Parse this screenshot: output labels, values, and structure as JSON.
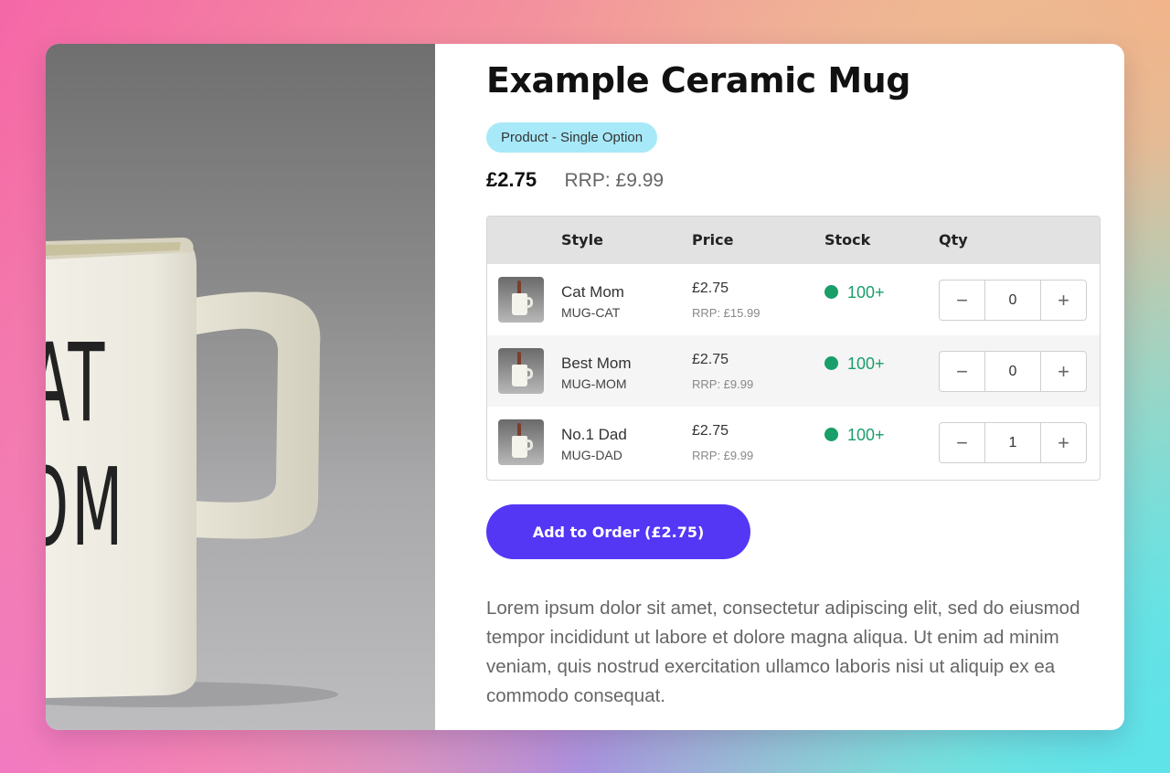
{
  "product": {
    "title": "Example Ceramic Mug",
    "badge": "Product - Single Option",
    "price": "£2.75",
    "rrp": "RRP: £9.99",
    "image_alt": "White ceramic mug",
    "mug_print": [
      "AT",
      "OM"
    ]
  },
  "table": {
    "headers": {
      "style": "Style",
      "price": "Price",
      "stock": "Stock",
      "qty": "Qty"
    },
    "rows": [
      {
        "name": "Cat Mom",
        "sku": "MUG-CAT",
        "price": "£2.75",
        "rrp": "RRP: £15.99",
        "stock": "100+",
        "qty": "0"
      },
      {
        "name": "Best Mom",
        "sku": "MUG-MOM",
        "price": "£2.75",
        "rrp": "RRP: £9.99",
        "stock": "100+",
        "qty": "0"
      },
      {
        "name": "No.1 Dad",
        "sku": "MUG-DAD",
        "price": "£2.75",
        "rrp": "RRP: £9.99",
        "stock": "100+",
        "qty": "1"
      }
    ],
    "minus_glyph": "−",
    "plus_glyph": "+"
  },
  "actions": {
    "add_to_order": "Add to Order (£2.75)"
  },
  "description": "Lorem ipsum dolor sit amet, consectetur adipiscing elit, sed do eiusmod tempor incididunt ut labore et dolore magna aliqua. Ut enim ad minim veniam, quis nostrud exercitation ullamco laboris nisi ut aliquip ex ea commodo consequat.",
  "colors": {
    "accent": "#5437f5",
    "badge": "#a7e9f8",
    "stock": "#1a9e6a"
  }
}
